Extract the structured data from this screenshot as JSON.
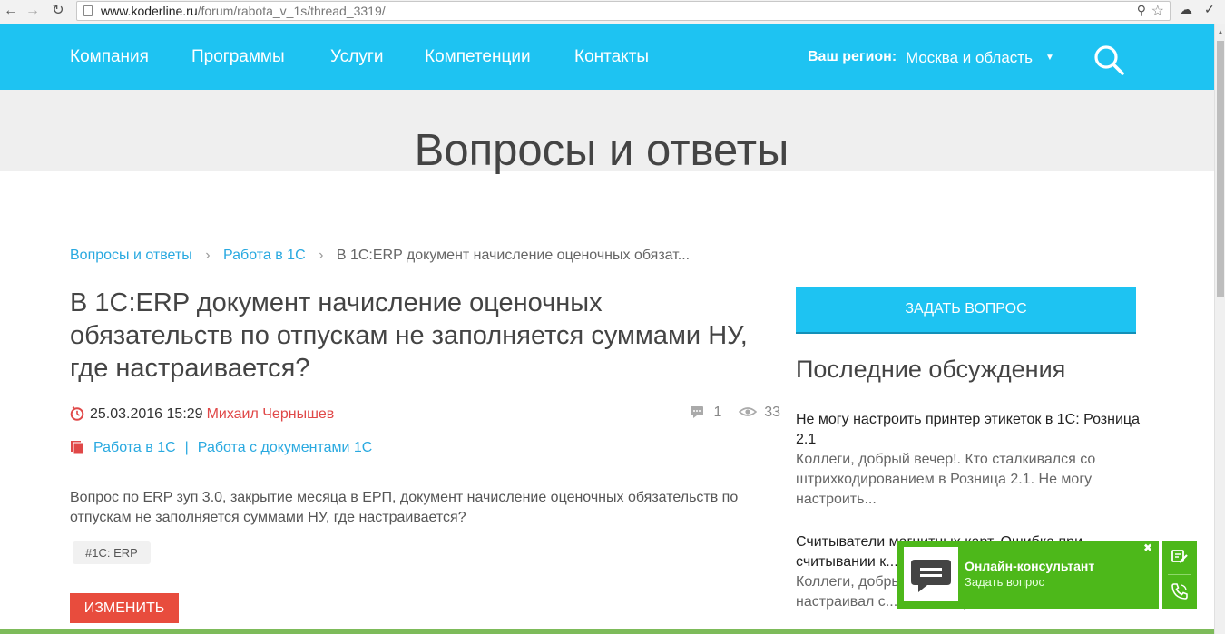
{
  "browser": {
    "url_host": "www.koderline.ru",
    "url_path": "/forum/rabota_v_1s/thread_3319/"
  },
  "nav": {
    "items": [
      "Компания",
      "Программы",
      "Услуги",
      "Компетенции",
      "Контакты"
    ],
    "region_label": "Ваш регион:",
    "region_value": "Москва и область"
  },
  "hero": {
    "title": "Вопросы и ответы"
  },
  "breadcrumb": {
    "items": [
      "Вопросы и ответы",
      "Работа в 1С"
    ],
    "current": "В 1С:ERP документ начисление оценочных обязат..."
  },
  "question": {
    "title": "В 1С:ERP документ начисление оценочных обязательств по отпускам не заполняется суммами НУ, где настраивается?",
    "datetime": "25.03.2016 15:29",
    "author": "Михаил Чернышев",
    "comments_count": "1",
    "views_count": "33",
    "categories": [
      "Работа в 1С",
      "Работа с документами 1С"
    ],
    "body": "Вопрос по ERP зуп 3.0, закрытие месяца в ЕРП, документ начисление оценочных обязательств по отпускам не заполняется суммами НУ, где настраивается?",
    "tag": "#1С: ERP",
    "edit_label": "Изменить"
  },
  "sidebar": {
    "ask_button": "ЗАДАТЬ ВОПРОС",
    "title": "Последние обсуждения",
    "discussions": [
      {
        "title": "Не могу настроить принтер этикеток в 1С: Розница 2.1",
        "text": "Коллеги, добрый вечер!. Кто сталкивался со штрихкодированием в Розница 2.1. Не могу настроить..."
      },
      {
        "title": "Считыватели магнитных карт. Ошибка при считывании к...",
        "text": "Коллеги, добрый день! Кто-то сталкивался и настраивал с... Он мне при..."
      }
    ]
  },
  "consultant": {
    "title": "Онлайн-консультант",
    "subtitle": "Задать вопрос"
  },
  "colors": {
    "nav_bg": "#1ec3f2",
    "link": "#29a9e0",
    "author": "#e04848",
    "edit_button": "#e84c3d",
    "consultant_bg": "#4db81a"
  }
}
